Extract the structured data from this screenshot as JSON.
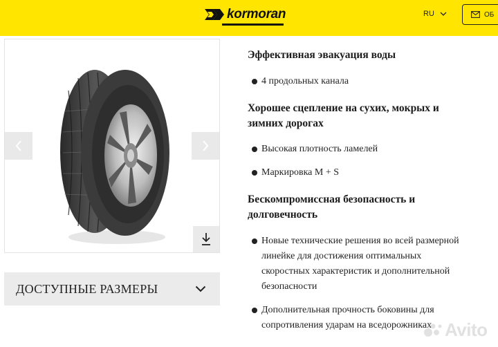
{
  "header": {
    "brand": "kormoran",
    "language": "RU",
    "feedback_label": "ОБ",
    "colors": {
      "background": "#ffe500",
      "text": "#111111"
    }
  },
  "gallery": {
    "prev_icon": "chevron-left-icon",
    "next_icon": "chevron-right-icon",
    "download_icon": "download-icon",
    "image_subject": "tire"
  },
  "sizes": {
    "label": "ДОСТУПНЫЕ РАЗМЕРЫ",
    "icon": "chevron-down-icon"
  },
  "features": [
    {
      "heading_lines": [
        "Эффективная эвакуация воды"
      ],
      "bullets": [
        {
          "lines": [
            "4 продольных канала"
          ]
        }
      ]
    },
    {
      "heading_lines": [
        "Хорошее сцепление на сухих, мокрых и",
        "зимних дорогах"
      ],
      "bullets": [
        {
          "lines": [
            "Высокая плотность ламелей"
          ]
        },
        {
          "lines": [
            "Маркировка M + S"
          ]
        }
      ]
    },
    {
      "heading_lines": [
        "Бескомпромиссная безопасность и",
        "долговечность"
      ],
      "bullets": [
        {
          "lines": [
            "Новые технические решения во всей размерной",
            "линейке для достижения оптимальных",
            "скоростных характеристик и дополнительной",
            "безопасности"
          ]
        },
        {
          "lines": [
            "Дополнительная прочность боковины для",
            "сопротивления ударам на вседорожниках"
          ]
        }
      ]
    }
  ],
  "watermark": {
    "text": "Avito"
  }
}
